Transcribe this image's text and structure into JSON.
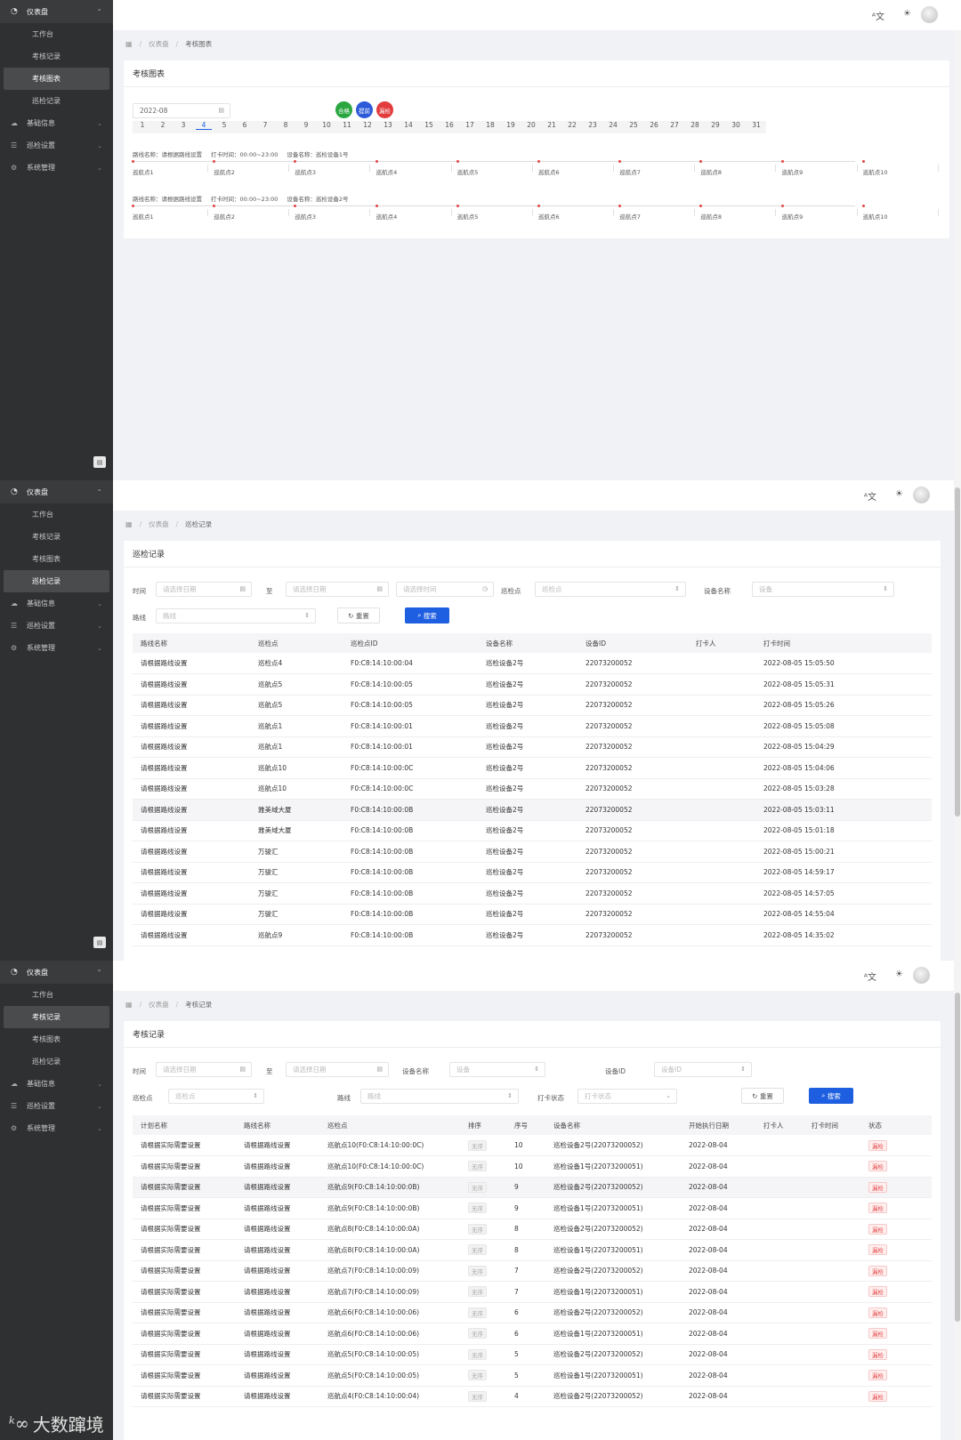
{
  "sidebar": {
    "head": "仪表盘",
    "subs": [
      "工作台",
      "考核记录",
      "考核图表",
      "巡检记录"
    ],
    "groups": [
      "基础信息",
      "巡检设置",
      "系统管理"
    ]
  },
  "breadcrumb": {
    "root": "仪表盘"
  },
  "panel1": {
    "crumb": "考核图表",
    "title": "考核图表",
    "month": "2022-08",
    "legend": [
      "合格",
      "提前",
      "漏检"
    ],
    "legend_colors": [
      "#2aa640",
      "#2c5ad9",
      "#e23c3c"
    ],
    "days": [
      "1",
      "2",
      "3",
      "4",
      "5",
      "6",
      "7",
      "8",
      "9",
      "10",
      "11",
      "12",
      "13",
      "14",
      "15",
      "16",
      "17",
      "18",
      "19",
      "20",
      "21",
      "22",
      "23",
      "24",
      "25",
      "26",
      "27",
      "28",
      "29",
      "30",
      "31"
    ],
    "routes": [
      {
        "name": "路线名称：请根据路线设置",
        "time": "打卡时间：00:00~23:00",
        "device": "设备名称：巡检设备1号"
      },
      {
        "name": "路线名称：请根据路线设置",
        "time": "打卡时间：00:00~23:00",
        "device": "设备名称：巡检设备2号"
      }
    ],
    "points": [
      "巡航点1",
      "巡航点2",
      "巡航点3",
      "巡航点4",
      "巡航点5",
      "巡航点6",
      "巡航点7",
      "巡航点8",
      "巡航点9",
      "巡航点10"
    ]
  },
  "panel2": {
    "crumb": "巡检记录",
    "title": "巡检记录",
    "filters": {
      "time_label": "时间",
      "date_ph": "请选择日期",
      "to": "至",
      "time_ph": "请选择时间",
      "point_label": "巡检点",
      "point_ph": "巡检点",
      "device_label": "设备名称",
      "device_ph": "设备",
      "route_label": "路线",
      "route_ph": "路线",
      "reset": "重置",
      "search": "搜索"
    },
    "columns": [
      "路线名称",
      "巡检点",
      "巡检点ID",
      "设备名称",
      "设备ID",
      "打卡人",
      "打卡时间"
    ],
    "rows": [
      [
        "请根据路线设置",
        "巡检点4",
        "F0:C8:14:10:00:04",
        "巡检设备2号",
        "22073200052",
        "",
        "2022-08-05 15:05:50"
      ],
      [
        "请根据路线设置",
        "巡航点5",
        "F0:C8:14:10:00:05",
        "巡检设备2号",
        "22073200052",
        "",
        "2022-08-05 15:05:31"
      ],
      [
        "请根据路线设置",
        "巡航点5",
        "F0:C8:14:10:00:05",
        "巡检设备2号",
        "22073200052",
        "",
        "2022-08-05 15:05:26"
      ],
      [
        "请根据路线设置",
        "巡航点1",
        "F0:C8:14:10:00:01",
        "巡检设备2号",
        "22073200052",
        "",
        "2022-08-05 15:05:08"
      ],
      [
        "请根据路线设置",
        "巡航点1",
        "F0:C8:14:10:00:01",
        "巡检设备2号",
        "22073200052",
        "",
        "2022-08-05 15:04:29"
      ],
      [
        "请根据路线设置",
        "巡航点10",
        "F0:C8:14:10:00:0C",
        "巡检设备2号",
        "22073200052",
        "",
        "2022-08-05 15:04:06"
      ],
      [
        "请根据路线设置",
        "巡航点10",
        "F0:C8:14:10:00:0C",
        "巡检设备2号",
        "22073200052",
        "",
        "2022-08-05 15:03:28"
      ],
      [
        "请根据路线设置",
        "雅美域大厦",
        "F0:C8:14:10:00:0B",
        "巡检设备2号",
        "22073200052",
        "",
        "2022-08-05 15:03:11"
      ],
      [
        "请根据路线设置",
        "雅美域大厦",
        "F0:C8:14:10:00:0B",
        "巡检设备2号",
        "22073200052",
        "",
        "2022-08-05 15:01:18"
      ],
      [
        "请根据路线设置",
        "万骏汇",
        "F0:C8:14:10:00:0B",
        "巡检设备2号",
        "22073200052",
        "",
        "2022-08-05 15:00:21"
      ],
      [
        "请根据路线设置",
        "万骏汇",
        "F0:C8:14:10:00:0B",
        "巡检设备2号",
        "22073200052",
        "",
        "2022-08-05 14:59:17"
      ],
      [
        "请根据路线设置",
        "万骏汇",
        "F0:C8:14:10:00:0B",
        "巡检设备2号",
        "22073200052",
        "",
        "2022-08-05 14:57:05"
      ],
      [
        "请根据路线设置",
        "万骏汇",
        "F0:C8:14:10:00:0B",
        "巡检设备2号",
        "22073200052",
        "",
        "2022-08-05 14:55:04"
      ],
      [
        "请根据路线设置",
        "巡航点9",
        "F0:C8:14:10:00:0B",
        "巡检设备2号",
        "22073200052",
        "",
        "2022-08-05 14:35:02"
      ]
    ]
  },
  "panel3": {
    "crumb": "考核记录",
    "title": "考核记录",
    "filters": {
      "time_label": "时间",
      "date_ph": "请选择日期",
      "to": "至",
      "device_label": "设备名称",
      "device_ph": "设备",
      "devid_label": "设备ID",
      "devid_ph": "设备ID",
      "point_label": "巡检点",
      "point_ph": "巡检点",
      "route_label": "路线",
      "route_ph": "路线",
      "status_label": "打卡状态",
      "status_ph": "打卡状态",
      "reset": "重置",
      "search": "搜索"
    },
    "columns": [
      "计划名称",
      "路线名称",
      "巡检点",
      "排序",
      "序号",
      "设备名称",
      "开始执行日期",
      "打卡人",
      "打卡时间",
      "状态"
    ],
    "rows": [
      [
        "请根据实际需要设置",
        "请根据路线设置",
        "巡航点10(F0:C8:14:10:00:0C)",
        "无序",
        "10",
        "巡检设备2号(22073200052)",
        "2022-08-04",
        "",
        "",
        "漏检"
      ],
      [
        "请根据实际需要设置",
        "请根据路线设置",
        "巡航点10(F0:C8:14:10:00:0C)",
        "无序",
        "10",
        "巡检设备1号(22073200051)",
        "2022-08-04",
        "",
        "",
        "漏检"
      ],
      [
        "请根据实际需要设置",
        "请根据路线设置",
        "巡航点9(F0:C8:14:10:00:0B)",
        "无序",
        "9",
        "巡检设备2号(22073200052)",
        "2022-08-04",
        "",
        "",
        "漏检"
      ],
      [
        "请根据实际需要设置",
        "请根据路线设置",
        "巡航点9(F0:C8:14:10:00:0B)",
        "无序",
        "9",
        "巡检设备1号(22073200051)",
        "2022-08-04",
        "",
        "",
        "漏检"
      ],
      [
        "请根据实际需要设置",
        "请根据路线设置",
        "巡航点8(F0:C8:14:10:00:0A)",
        "无序",
        "8",
        "巡检设备2号(22073200052)",
        "2022-08-04",
        "",
        "",
        "漏检"
      ],
      [
        "请根据实际需要设置",
        "请根据路线设置",
        "巡航点8(F0:C8:14:10:00:0A)",
        "无序",
        "8",
        "巡检设备1号(22073200051)",
        "2022-08-04",
        "",
        "",
        "漏检"
      ],
      [
        "请根据实际需要设置",
        "请根据路线设置",
        "巡航点7(F0:C8:14:10:00:09)",
        "无序",
        "7",
        "巡检设备2号(22073200052)",
        "2022-08-04",
        "",
        "",
        "漏检"
      ],
      [
        "请根据实际需要设置",
        "请根据路线设置",
        "巡航点7(F0:C8:14:10:00:09)",
        "无序",
        "7",
        "巡检设备1号(22073200051)",
        "2022-08-04",
        "",
        "",
        "漏检"
      ],
      [
        "请根据实际需要设置",
        "请根据路线设置",
        "巡航点6(F0:C8:14:10:00:06)",
        "无序",
        "6",
        "巡检设备2号(22073200052)",
        "2022-08-04",
        "",
        "",
        "漏检"
      ],
      [
        "请根据实际需要设置",
        "请根据路线设置",
        "巡航点6(F0:C8:14:10:00:06)",
        "无序",
        "6",
        "巡检设备1号(22073200051)",
        "2022-08-04",
        "",
        "",
        "漏检"
      ],
      [
        "请根据实际需要设置",
        "请根据路线设置",
        "巡航点5(F0:C8:14:10:00:05)",
        "无序",
        "5",
        "巡检设备2号(22073200052)",
        "2022-08-04",
        "",
        "",
        "漏检"
      ],
      [
        "请根据实际需要设置",
        "请根据路线设置",
        "巡航点5(F0:C8:14:10:00:05)",
        "无序",
        "5",
        "巡检设备1号(22073200051)",
        "2022-08-04",
        "",
        "",
        "漏检"
      ],
      [
        "请根据实际需要设置",
        "请根据路线设置",
        "巡航点4(F0:C8:14:10:00:04)",
        "无序",
        "4",
        "巡检设备2号(22073200052)",
        "2022-08-04",
        "",
        "",
        "漏检"
      ]
    ]
  },
  "watermark": "大数蹿境"
}
